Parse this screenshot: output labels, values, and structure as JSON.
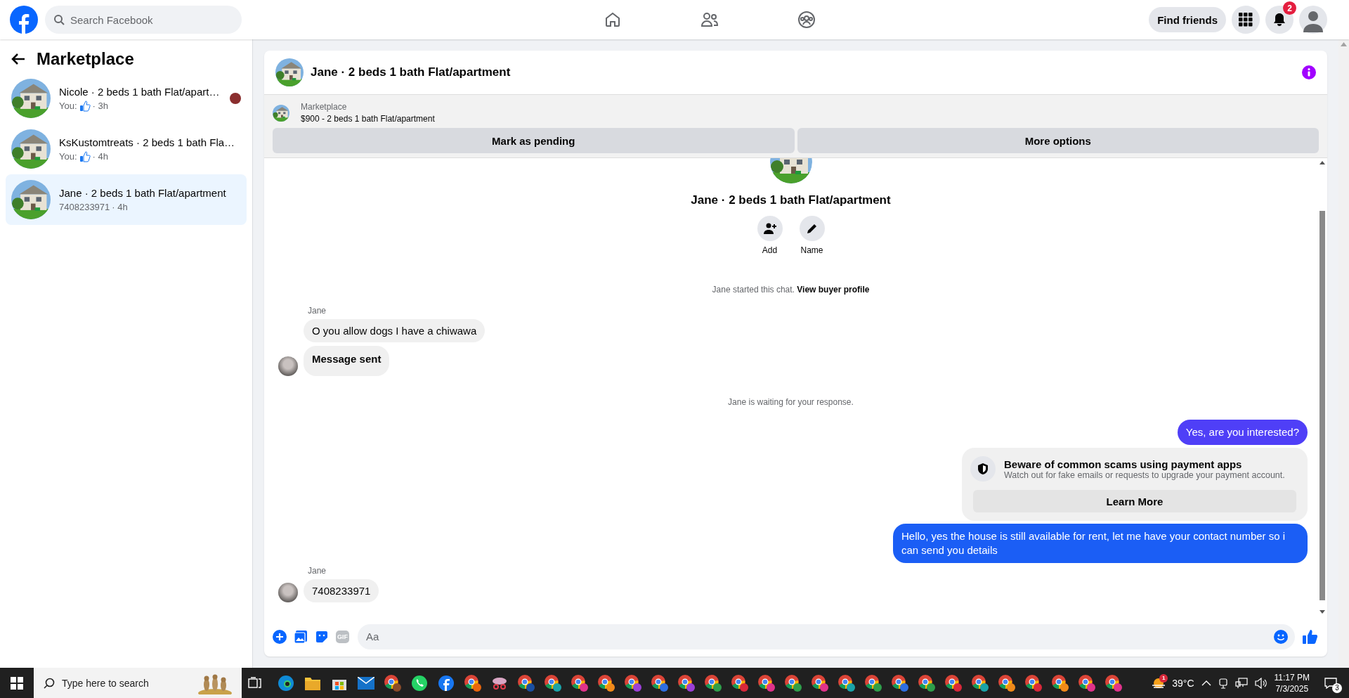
{
  "topbar": {
    "search": {
      "placeholder": "Search Facebook"
    },
    "nav": [
      {
        "kind": "home"
      },
      {
        "kind": "friends"
      },
      {
        "kind": "groups"
      }
    ],
    "find_friends": "Find friends",
    "notifications_badge": "2"
  },
  "sidebar": {
    "title": "Marketplace",
    "conversations": [
      {
        "title": "Nicole · 2 beds 1 bath Flat/apart…",
        "preview": "You:",
        "like": true,
        "time": "· 3h",
        "seen": true,
        "selected": false
      },
      {
        "title": "KsKustomtreats · 2 beds 1 bath Fla…",
        "preview": "You:",
        "like": true,
        "time": "· 4h",
        "seen": false,
        "selected": false
      },
      {
        "title": "Jane · 2 beds 1 bath Flat/apartment",
        "preview": "7408233971",
        "like": false,
        "time": "· 4h",
        "seen": false,
        "selected": true
      }
    ]
  },
  "chat": {
    "title": "Jane · 2 beds 1 bath Flat/apartment",
    "listing": {
      "source": "Marketplace",
      "summary": "$900 - 2 beds 1 bath Flat/apartment",
      "buttons": [
        "Mark as pending",
        "More options"
      ]
    },
    "intro": {
      "title": "Jane · 2 beds 1 bath Flat/apartment",
      "actions": [
        {
          "kind": "add",
          "label": "Add"
        },
        {
          "kind": "name",
          "label": "Name"
        }
      ]
    },
    "messages": [
      {
        "kind": "system",
        "text": "Jane started this chat.",
        "link": "View buyer profile"
      },
      {
        "kind": "incoming",
        "sender": "Jane",
        "bubbles": [
          {
            "text": "O you allow dogs I have a chiwawa",
            "bold": false
          },
          {
            "text": "Message sent",
            "bold": true
          }
        ]
      },
      {
        "kind": "system",
        "text": "Jane is waiting for your response."
      },
      {
        "kind": "outgoing",
        "text": "Yes, are you interested?",
        "color": "#4f3ff7"
      },
      {
        "kind": "notice",
        "title": "Beware of common scams using payment apps",
        "body": "Watch out for fake emails or requests to upgrade your payment account.",
        "button": "Learn More"
      },
      {
        "kind": "outgoing",
        "text": "Hello, yes the house is still available for rent, let me have your contact number so i can send you details",
        "color": "#1b5ef5"
      },
      {
        "kind": "incoming",
        "sender": "Jane",
        "bubbles": [
          {
            "text": "7408233971",
            "bold": false
          }
        ]
      }
    ],
    "composer": {
      "placeholder": "Aa",
      "gif": "GIF"
    }
  },
  "taskbar": {
    "search": {
      "placeholder": "Type here to search"
    },
    "apps": [
      {
        "kind": "edge"
      },
      {
        "kind": "files"
      },
      {
        "kind": "store"
      },
      {
        "kind": "mail"
      },
      {
        "kind": "chrome",
        "color": "#8a4b2a"
      },
      {
        "kind": "whatsapp"
      },
      {
        "kind": "facebook"
      },
      {
        "kind": "chrome",
        "color": "#e8650c"
      },
      {
        "kind": "snip"
      },
      {
        "kind": "chrome",
        "color": "#1a4fa0"
      },
      {
        "kind": "chrome",
        "color": "#1aa3a8"
      },
      {
        "kind": "chrome",
        "color": "#e0338a"
      },
      {
        "kind": "chrome",
        "color": "#f08a1a"
      },
      {
        "kind": "chrome",
        "color": "#9b3fd6"
      },
      {
        "kind": "chrome",
        "color": "#2f6fe0"
      },
      {
        "kind": "chrome",
        "color": "#9b3fd6"
      },
      {
        "kind": "chrome",
        "color": "#2e9e4a"
      },
      {
        "kind": "chrome",
        "color": "#d8283a"
      },
      {
        "kind": "chrome",
        "color": "#e0338a"
      },
      {
        "kind": "chrome",
        "color": "#2e9e4a"
      },
      {
        "kind": "chrome",
        "color": "#e0338a"
      },
      {
        "kind": "chrome",
        "color": "#1aa3a8"
      },
      {
        "kind": "chrome",
        "color": "#2e9e4a"
      },
      {
        "kind": "chrome",
        "color": "#2f6fe0"
      },
      {
        "kind": "chrome",
        "color": "#2e9e4a"
      },
      {
        "kind": "chrome",
        "color": "#d8283a"
      },
      {
        "kind": "chrome",
        "color": "#1aa3a8"
      },
      {
        "kind": "chrome",
        "color": "#f08a1a"
      },
      {
        "kind": "chrome",
        "color": "#d8283a"
      },
      {
        "kind": "chrome",
        "color": "#f08a1a"
      },
      {
        "kind": "chrome",
        "color": "#e0338a"
      },
      {
        "kind": "chrome",
        "color": "#e0338a"
      }
    ],
    "weather": {
      "temp": "39°C",
      "badge": "1"
    },
    "time": "11:17 PM",
    "date": "7/3/2025",
    "notification_count": "3"
  }
}
